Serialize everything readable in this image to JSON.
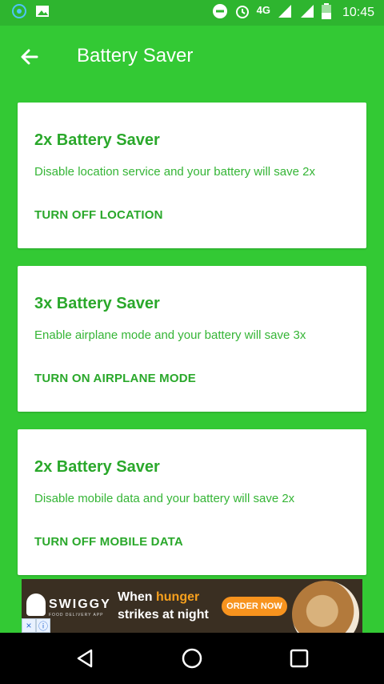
{
  "status_bar": {
    "network": "4G",
    "time": "10:45"
  },
  "app_bar": {
    "title": "Battery Saver",
    "back_icon": "arrow-left-icon"
  },
  "cards": [
    {
      "title": "2x Battery Saver",
      "description": "Disable location service and your battery will save 2x",
      "action": "TURN OFF LOCATION"
    },
    {
      "title": "3x Battery Saver",
      "description": "Enable airplane mode and your battery will save 3x",
      "action": "TURN ON AIRPLANE MODE"
    },
    {
      "title": "2x Battery Saver",
      "description": "Disable mobile data and your battery will save 2x",
      "action": "TURN OFF MOBILE DATA"
    }
  ],
  "ad": {
    "brand": "SWIGGY",
    "brand_sub": "FOOD DELIVERY APP",
    "line1_prefix": "When ",
    "line1_highlight": "hunger",
    "line2": "strikes at night",
    "cta": "ORDER NOW"
  },
  "colors": {
    "background": "#33c934",
    "status_bar": "#2eb52f",
    "card": "#ffffff",
    "accent_text": "#2aa82b"
  },
  "nav_bar": {
    "back_icon": "triangle-back-icon",
    "home_icon": "circle-home-icon",
    "recents_icon": "square-recents-icon"
  }
}
